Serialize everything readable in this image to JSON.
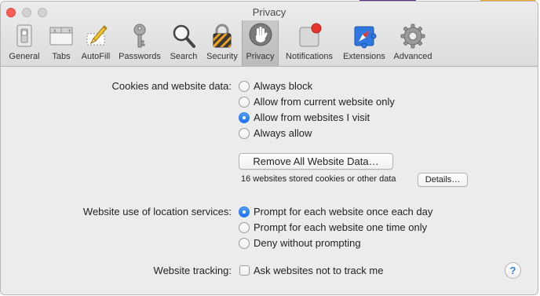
{
  "window": {
    "title": "Privacy"
  },
  "toolbar": {
    "tabs": [
      {
        "label": "General",
        "icon": "general-switch-icon",
        "selected": false
      },
      {
        "label": "Tabs",
        "icon": "tabs-window-icon",
        "selected": false
      },
      {
        "label": "AutoFill",
        "icon": "autofill-pencil-icon",
        "selected": false
      },
      {
        "label": "Passwords",
        "icon": "key-icon",
        "selected": false
      },
      {
        "label": "Search",
        "icon": "magnifier-icon",
        "selected": false
      },
      {
        "label": "Security",
        "icon": "lock-icon",
        "selected": false
      },
      {
        "label": "Privacy",
        "icon": "hand-icon",
        "selected": true
      },
      {
        "label": "Notifications",
        "icon": "notification-badge-icon",
        "selected": false
      },
      {
        "label": "Extensions",
        "icon": "compass-puzzle-icon",
        "selected": false
      },
      {
        "label": "Advanced",
        "icon": "gear-icon",
        "selected": false
      }
    ]
  },
  "cookies": {
    "label": "Cookies and website data:",
    "options": [
      {
        "label": "Always block",
        "checked": false
      },
      {
        "label": "Allow from current website only",
        "checked": false
      },
      {
        "label": "Allow from websites I visit",
        "checked": true
      },
      {
        "label": "Always allow",
        "checked": false
      }
    ],
    "remove_button": "Remove All Website Data…",
    "stored_text": "16 websites stored cookies or other data",
    "details_button": "Details…"
  },
  "location": {
    "label": "Website use of location services:",
    "options": [
      {
        "label": "Prompt for each website once each day",
        "checked": true
      },
      {
        "label": "Prompt for each website one time only",
        "checked": false
      },
      {
        "label": "Deny without prompting",
        "checked": false
      }
    ]
  },
  "tracking": {
    "label": "Website tracking:",
    "checkbox_label": "Ask websites not to track me",
    "checked": false
  },
  "help": {
    "label": "?"
  },
  "colors": {
    "accent": "#2f7fe6",
    "close": "#fc5f57",
    "window_bg": "#ececec"
  }
}
